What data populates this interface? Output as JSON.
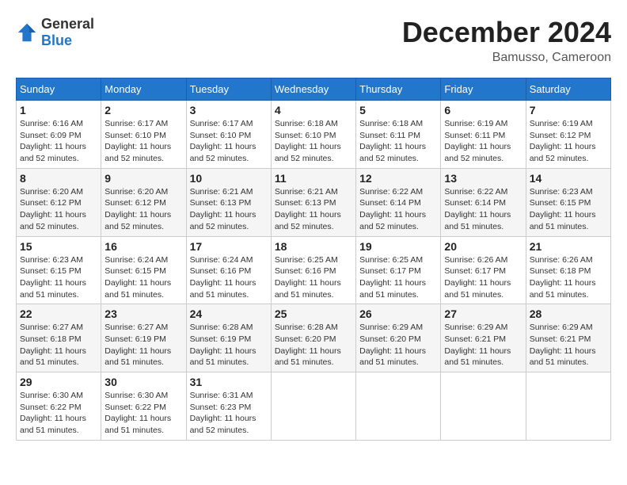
{
  "header": {
    "logo_general": "General",
    "logo_blue": "Blue",
    "month_year": "December 2024",
    "location": "Bamusso, Cameroon"
  },
  "calendar": {
    "days_of_week": [
      "Sunday",
      "Monday",
      "Tuesday",
      "Wednesday",
      "Thursday",
      "Friday",
      "Saturday"
    ],
    "weeks": [
      [
        {
          "day": "1",
          "sunrise": "6:16 AM",
          "sunset": "6:09 PM",
          "daylight": "11 hours and 52 minutes."
        },
        {
          "day": "2",
          "sunrise": "6:17 AM",
          "sunset": "6:10 PM",
          "daylight": "11 hours and 52 minutes."
        },
        {
          "day": "3",
          "sunrise": "6:17 AM",
          "sunset": "6:10 PM",
          "daylight": "11 hours and 52 minutes."
        },
        {
          "day": "4",
          "sunrise": "6:18 AM",
          "sunset": "6:10 PM",
          "daylight": "11 hours and 52 minutes."
        },
        {
          "day": "5",
          "sunrise": "6:18 AM",
          "sunset": "6:11 PM",
          "daylight": "11 hours and 52 minutes."
        },
        {
          "day": "6",
          "sunrise": "6:19 AM",
          "sunset": "6:11 PM",
          "daylight": "11 hours and 52 minutes."
        },
        {
          "day": "7",
          "sunrise": "6:19 AM",
          "sunset": "6:12 PM",
          "daylight": "11 hours and 52 minutes."
        }
      ],
      [
        {
          "day": "8",
          "sunrise": "6:20 AM",
          "sunset": "6:12 PM",
          "daylight": "11 hours and 52 minutes."
        },
        {
          "day": "9",
          "sunrise": "6:20 AM",
          "sunset": "6:12 PM",
          "daylight": "11 hours and 52 minutes."
        },
        {
          "day": "10",
          "sunrise": "6:21 AM",
          "sunset": "6:13 PM",
          "daylight": "11 hours and 52 minutes."
        },
        {
          "day": "11",
          "sunrise": "6:21 AM",
          "sunset": "6:13 PM",
          "daylight": "11 hours and 52 minutes."
        },
        {
          "day": "12",
          "sunrise": "6:22 AM",
          "sunset": "6:14 PM",
          "daylight": "11 hours and 52 minutes."
        },
        {
          "day": "13",
          "sunrise": "6:22 AM",
          "sunset": "6:14 PM",
          "daylight": "11 hours and 51 minutes."
        },
        {
          "day": "14",
          "sunrise": "6:23 AM",
          "sunset": "6:15 PM",
          "daylight": "11 hours and 51 minutes."
        }
      ],
      [
        {
          "day": "15",
          "sunrise": "6:23 AM",
          "sunset": "6:15 PM",
          "daylight": "11 hours and 51 minutes."
        },
        {
          "day": "16",
          "sunrise": "6:24 AM",
          "sunset": "6:15 PM",
          "daylight": "11 hours and 51 minutes."
        },
        {
          "day": "17",
          "sunrise": "6:24 AM",
          "sunset": "6:16 PM",
          "daylight": "11 hours and 51 minutes."
        },
        {
          "day": "18",
          "sunrise": "6:25 AM",
          "sunset": "6:16 PM",
          "daylight": "11 hours and 51 minutes."
        },
        {
          "day": "19",
          "sunrise": "6:25 AM",
          "sunset": "6:17 PM",
          "daylight": "11 hours and 51 minutes."
        },
        {
          "day": "20",
          "sunrise": "6:26 AM",
          "sunset": "6:17 PM",
          "daylight": "11 hours and 51 minutes."
        },
        {
          "day": "21",
          "sunrise": "6:26 AM",
          "sunset": "6:18 PM",
          "daylight": "11 hours and 51 minutes."
        }
      ],
      [
        {
          "day": "22",
          "sunrise": "6:27 AM",
          "sunset": "6:18 PM",
          "daylight": "11 hours and 51 minutes."
        },
        {
          "day": "23",
          "sunrise": "6:27 AM",
          "sunset": "6:19 PM",
          "daylight": "11 hours and 51 minutes."
        },
        {
          "day": "24",
          "sunrise": "6:28 AM",
          "sunset": "6:19 PM",
          "daylight": "11 hours and 51 minutes."
        },
        {
          "day": "25",
          "sunrise": "6:28 AM",
          "sunset": "6:20 PM",
          "daylight": "11 hours and 51 minutes."
        },
        {
          "day": "26",
          "sunrise": "6:29 AM",
          "sunset": "6:20 PM",
          "daylight": "11 hours and 51 minutes."
        },
        {
          "day": "27",
          "sunrise": "6:29 AM",
          "sunset": "6:21 PM",
          "daylight": "11 hours and 51 minutes."
        },
        {
          "day": "28",
          "sunrise": "6:29 AM",
          "sunset": "6:21 PM",
          "daylight": "11 hours and 51 minutes."
        }
      ],
      [
        {
          "day": "29",
          "sunrise": "6:30 AM",
          "sunset": "6:22 PM",
          "daylight": "11 hours and 51 minutes."
        },
        {
          "day": "30",
          "sunrise": "6:30 AM",
          "sunset": "6:22 PM",
          "daylight": "11 hours and 51 minutes."
        },
        {
          "day": "31",
          "sunrise": "6:31 AM",
          "sunset": "6:23 PM",
          "daylight": "11 hours and 52 minutes."
        },
        null,
        null,
        null,
        null
      ]
    ]
  }
}
